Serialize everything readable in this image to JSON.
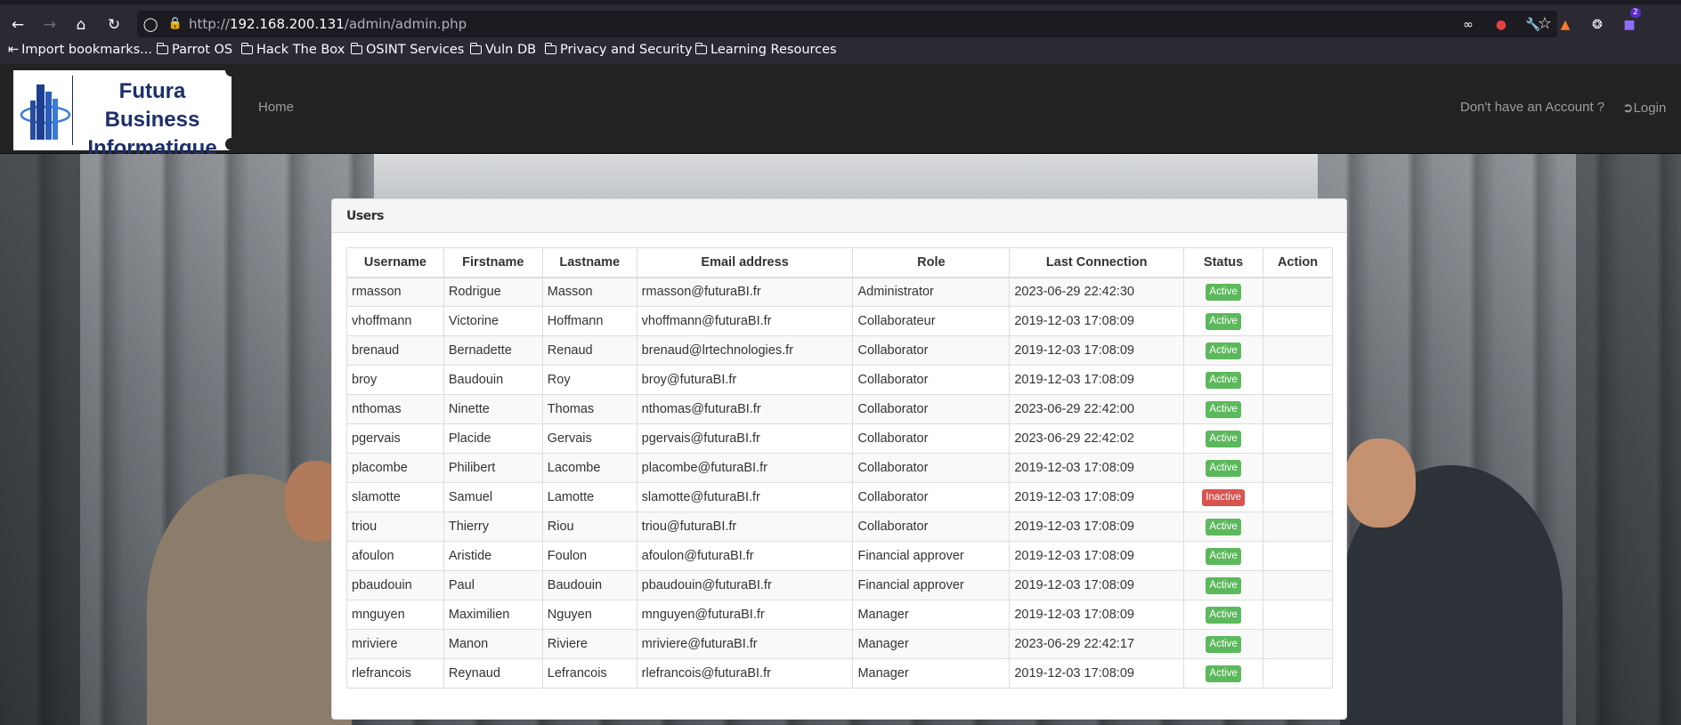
{
  "browser": {
    "url_prefix": "http://",
    "url_host": "192.168.200.131",
    "url_path": "/admin/admin.php",
    "extension_badge": "2",
    "bookmarks": [
      {
        "label": "Import bookmarks...",
        "icon": "import-icon"
      },
      {
        "label": "Parrot OS",
        "icon": "folder-icon"
      },
      {
        "label": "Hack The Box",
        "icon": "folder-icon"
      },
      {
        "label": "OSINT Services",
        "icon": "folder-icon"
      },
      {
        "label": "Vuln DB",
        "icon": "folder-icon"
      },
      {
        "label": "Privacy and Security",
        "icon": "folder-icon"
      },
      {
        "label": "Learning Resources",
        "icon": "folder-icon"
      }
    ]
  },
  "navbar": {
    "logo_line1": "Futura Business",
    "logo_line2": "Informatique",
    "home": "Home",
    "signup": "Don't have an Account ?",
    "login": "Login"
  },
  "panel": {
    "title": "Users",
    "columns": [
      "Username",
      "Firstname",
      "Lastname",
      "Email address",
      "Role",
      "Last Connection",
      "Status",
      "Action"
    ],
    "rows": [
      {
        "username": "rmasson",
        "firstname": "Rodrigue",
        "lastname": "Masson",
        "email": "rmasson@futuraBI.fr",
        "role": "Administrator",
        "last": "2023-06-29 22:42:30",
        "status": "Active"
      },
      {
        "username": "vhoffmann",
        "firstname": "Victorine",
        "lastname": "Hoffmann",
        "email": "vhoffmann@futuraBI.fr",
        "role": "Collaborateur",
        "last": "2019-12-03 17:08:09",
        "status": "Active"
      },
      {
        "username": "brenaud",
        "firstname": "Bernadette",
        "lastname": "Renaud",
        "email": "brenaud@lrtechnologies.fr",
        "role": "Collaborator",
        "last": "2019-12-03 17:08:09",
        "status": "Active"
      },
      {
        "username": "broy",
        "firstname": "Baudouin",
        "lastname": "Roy",
        "email": "broy@futuraBI.fr",
        "role": "Collaborator",
        "last": "2019-12-03 17:08:09",
        "status": "Active"
      },
      {
        "username": "nthomas",
        "firstname": "Ninette",
        "lastname": "Thomas",
        "email": "nthomas@futuraBI.fr",
        "role": "Collaborator",
        "last": "2023-06-29 22:42:00",
        "status": "Active"
      },
      {
        "username": "pgervais",
        "firstname": "Placide",
        "lastname": "Gervais",
        "email": "pgervais@futuraBI.fr",
        "role": "Collaborator",
        "last": "2023-06-29 22:42:02",
        "status": "Active"
      },
      {
        "username": "placombe",
        "firstname": "Philibert",
        "lastname": "Lacombe",
        "email": "placombe@futuraBI.fr",
        "role": "Collaborator",
        "last": "2019-12-03 17:08:09",
        "status": "Active"
      },
      {
        "username": "slamotte",
        "firstname": "Samuel",
        "lastname": "Lamotte",
        "email": "slamotte@futuraBI.fr",
        "role": "Collaborator",
        "last": "2019-12-03 17:08:09",
        "status": "Inactive"
      },
      {
        "username": "triou",
        "firstname": "Thierry",
        "lastname": "Riou",
        "email": "triou@futuraBI.fr",
        "role": "Collaborator",
        "last": "2019-12-03 17:08:09",
        "status": "Active"
      },
      {
        "username": "afoulon",
        "firstname": "Aristide",
        "lastname": "Foulon",
        "email": "afoulon@futuraBI.fr",
        "role": "Financial approver",
        "last": "2019-12-03 17:08:09",
        "status": "Active"
      },
      {
        "username": "pbaudouin",
        "firstname": "Paul",
        "lastname": "Baudouin",
        "email": "pbaudouin@futuraBI.fr",
        "role": "Financial approver",
        "last": "2019-12-03 17:08:09",
        "status": "Active"
      },
      {
        "username": "mnguyen",
        "firstname": "Maximilien",
        "lastname": "Nguyen",
        "email": "mnguyen@futuraBI.fr",
        "role": "Manager",
        "last": "2019-12-03 17:08:09",
        "status": "Active"
      },
      {
        "username": "mriviere",
        "firstname": "Manon",
        "lastname": "Riviere",
        "email": "mriviere@futuraBI.fr",
        "role": "Manager",
        "last": "2023-06-29 22:42:17",
        "status": "Active"
      },
      {
        "username": "rlefrancois",
        "firstname": "Reynaud",
        "lastname": "Lefrancois",
        "email": "rlefrancois@futuraBI.fr",
        "role": "Manager",
        "last": "2019-12-03 17:08:09",
        "status": "Active"
      }
    ]
  },
  "colors": {
    "active": "#5cb85c",
    "inactive": "#d9534f",
    "navbar": "#222222",
    "logo_text": "#1d2f6b"
  }
}
